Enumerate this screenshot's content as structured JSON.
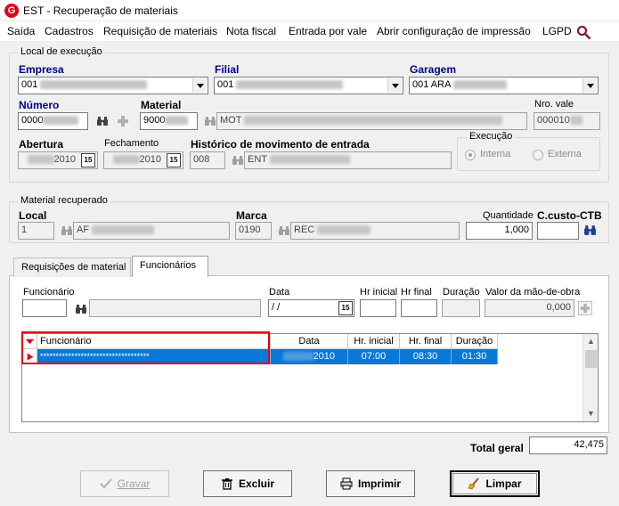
{
  "window": {
    "title": "EST - Recuperação de materiais",
    "app_icon_letter": "G"
  },
  "menu": [
    "Saída",
    "Cadastros",
    "Requisição de materiais",
    "Nota fiscal",
    "Entrada por vale",
    "Abrir configuração de impressão",
    "LGPD"
  ],
  "local_execucao": {
    "legend": "Local de execução",
    "empresa": {
      "label": "Empresa",
      "value": "001"
    },
    "filial": {
      "label": "Filial",
      "value": "001"
    },
    "garagem": {
      "label": "Garagem",
      "value": "001 ARA"
    },
    "numero": {
      "label": "Número",
      "value": "0000"
    },
    "material": {
      "label": "Material",
      "value": "9000",
      "description": "MOT"
    },
    "nro_vale": {
      "label": "Nro. vale",
      "value": "000010"
    },
    "abertura": {
      "label": "Abertura",
      "value": "2010"
    },
    "fechamento": {
      "label": "Fechamento",
      "value": "2010"
    },
    "historico": {
      "label": "Histórico de movimento de entrada",
      "code": "008",
      "description": "ENT"
    },
    "execucao": {
      "legend": "Execução",
      "interna": "Interna",
      "externa": "Externa",
      "selected": "Interna"
    }
  },
  "material_recuperado": {
    "legend": "Material recuperado",
    "local": {
      "label": "Local",
      "value": "1",
      "description": "AF"
    },
    "marca": {
      "label": "Marca",
      "value": "0190",
      "description": "REC"
    },
    "quantidade": {
      "label": "Quantidade",
      "value": "1,000"
    },
    "ccusto": {
      "label": "C.custo-CTB",
      "value": ""
    }
  },
  "tabs": [
    {
      "label": "Requisições de material",
      "active": false
    },
    {
      "label": "Funcionários",
      "active": true
    }
  ],
  "funcionarios": {
    "funcionario_label": "Funcionário",
    "data_label": "Data",
    "data_value": " /  /",
    "hr_inicial_label": "Hr inicial",
    "hr_final_label": "Hr final",
    "duracao_label": "Duração",
    "valor_label": "Valor da mão-de-obra",
    "valor_value": "0,000",
    "grid": {
      "columns": [
        "Funcionário",
        "Data",
        "Hr. inicial",
        "Hr. final",
        "Duração"
      ],
      "rows": [
        {
          "funcionario": "***********************************",
          "data": "2010",
          "hr_inicial": "07:00",
          "hr_final": "08:30",
          "duracao": "01:30"
        }
      ]
    }
  },
  "total_geral": {
    "label": "Total geral",
    "value": "42,475"
  },
  "buttons": {
    "gravar": "Gravar",
    "excluir": "Excluir",
    "imprimir": "Imprimir",
    "limpar": "Limpar"
  },
  "colors": {
    "selection": "#0a78d7",
    "highlight_box": "#e2001a",
    "label_blue": "#000080"
  }
}
